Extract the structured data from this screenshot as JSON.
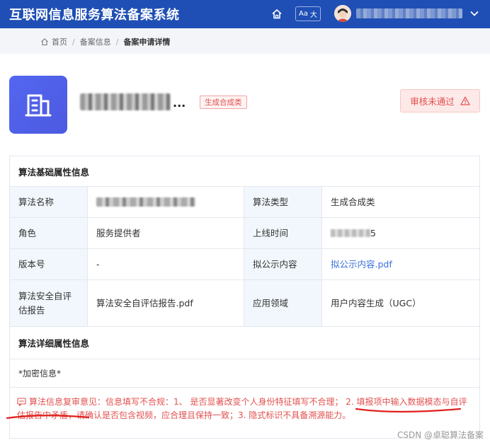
{
  "header": {
    "app_title": "互联网信息服务算法备案系统",
    "font_toggle_latin": "Aa",
    "font_toggle_cjk": "大",
    "icons": [
      "home-icon",
      "font-size-icon",
      "avatar",
      "chevron-down-icon"
    ]
  },
  "breadcrumb": {
    "items": [
      "首页",
      "备案信息",
      "备案申请详情"
    ]
  },
  "algorithm": {
    "name_suffix": "...",
    "type_tag": "生成合成类",
    "status": "审核未通过",
    "status_color": "#e2504f",
    "logo_icon": "building-icon"
  },
  "basic_section": {
    "title": "算法基础属性信息",
    "rows": [
      {
        "label1": "算法名称",
        "value1": "",
        "label2": "算法类型",
        "value2": "生成合成类"
      },
      {
        "label1": "角色",
        "value1": "服务提供者",
        "label2": "上线时间",
        "value2": "5"
      },
      {
        "label1": "版本号",
        "value1": "-",
        "label2": "拟公示内容",
        "value2": "拟公示内容.pdf"
      },
      {
        "label1": "算法安全自评估报告",
        "value1": "算法安全自评估报告.pdf",
        "label2": "应用领域",
        "value2": "用户内容生成（UGC）"
      }
    ]
  },
  "detail_section": {
    "title": "算法详细属性信息",
    "encrypted_note": "*加密信息*"
  },
  "review": {
    "text": "算法信息复审意见：信息填写不合规：1、 是否显著改变个人身份特征填写不合理； 2. 填报项中输入数据模态与自评估报告中矛盾，请确认是否包含视频，应合理且保持一致；3. 隐式标识不具备溯源能力。"
  },
  "watermark": "CSDN @卓聪算法备案",
  "colors": {
    "header_bg": "#1f4fb5",
    "accent_red": "#e2504f",
    "link_blue": "#3a6fd8",
    "label_bg": "#f1f7fc"
  }
}
